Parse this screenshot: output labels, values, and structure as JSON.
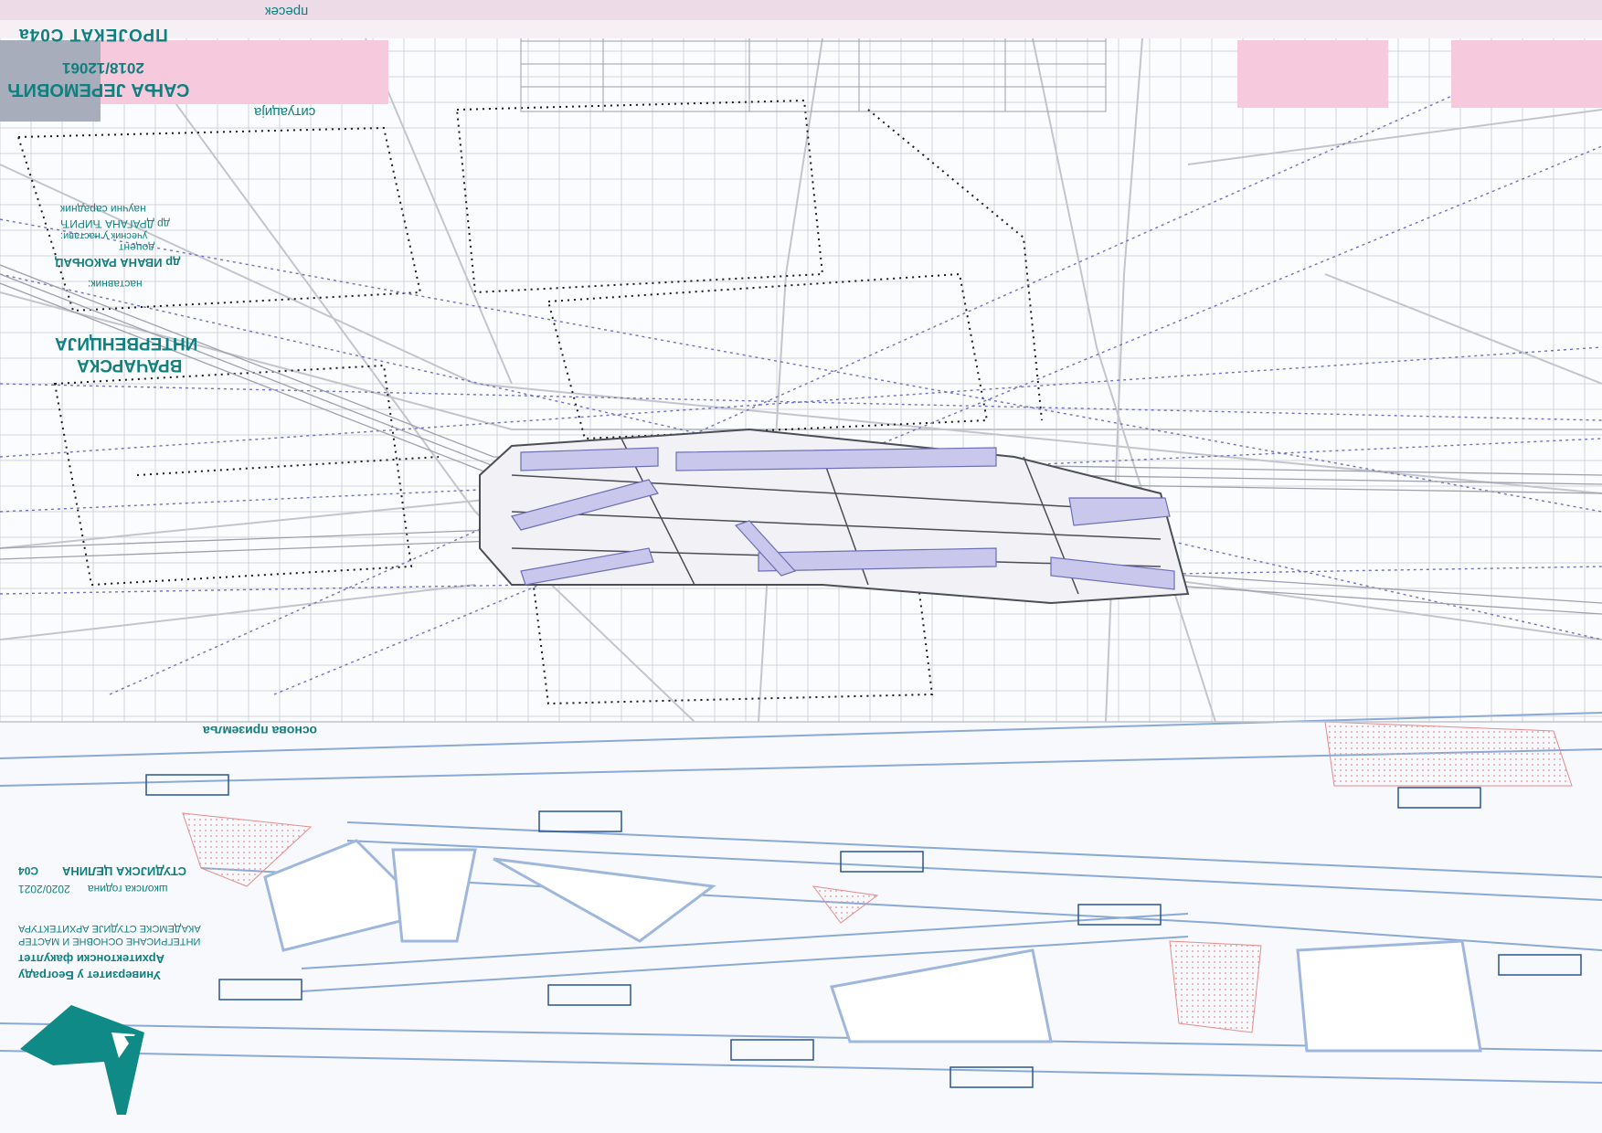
{
  "header": {
    "section_label": "пресек",
    "project_label": "ПРОЈЕКАТ    С04а",
    "author_name": "САЊА ЈЕРЕМОВИЋ",
    "student_index": "2018/12061",
    "situation_label": "ситуација"
  },
  "title_block": {
    "project_title_line1": "ВРАЧАРСКА",
    "project_title_line2": "ИНТЕРВЕНЦИЈА"
  },
  "mentors": {
    "heading": "наставник:",
    "mentor_1_name": "др ИВАНА РАКОЊАЦ",
    "mentor_1_role": "доцент",
    "mentor_2_role_line": "учесник у настави:",
    "mentor_2_name": "др ДРАГАНА ЋИРИЋ",
    "mentor_2_role": "научни сарадник"
  },
  "ground_floor": {
    "label": "основа приземља"
  },
  "university_block": {
    "university": "Универзитет у Београду",
    "faculty": "Архитектонски факултет",
    "program_line1": "ИНТЕГРИСАНЕ ОСНОВНЕ И МАСТЕР",
    "program_line2": "АКАДЕМСКЕ СТУДИЈЕ АРХИТЕКТУРА",
    "school_year_label": "школска година",
    "school_year": "2020/2021",
    "studio_label": "СТУДИЈСКА ЦЕЛИНА",
    "studio_code": "С04"
  },
  "colors": {
    "teal": "#0f7f7f",
    "pink": "#f7c9dc",
    "lavender": "#c9c8ec",
    "plan_blue": "#8aa9d6",
    "line_gray": "#b9bcc4",
    "dot_black": "#1a1a1a"
  }
}
